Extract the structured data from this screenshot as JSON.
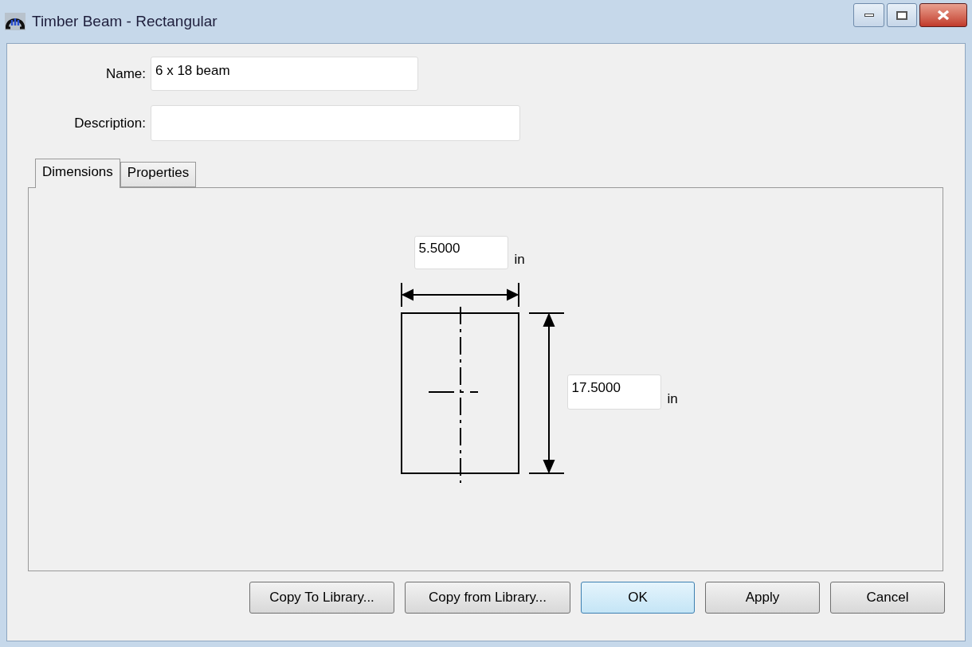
{
  "window": {
    "title": "Timber Beam - Rectangular"
  },
  "fields": [
    {
      "label": "Name:",
      "value": "6 x 18 beam"
    },
    {
      "label": "Description:"
    }
  ],
  "tabs": [
    {
      "label": "Dimensions",
      "selected": true
    },
    {
      "label": "Properties",
      "selected": false
    }
  ],
  "dimensions": {
    "width": {
      "value": "5.5000",
      "unit": "in"
    },
    "height": {
      "value": "17.5000",
      "unit": "in"
    }
  },
  "buttons": [
    {
      "label": "Copy To Library...",
      "default": false
    },
    {
      "label": "Copy from Library...",
      "default": false
    },
    {
      "label": "OK",
      "default": true
    },
    {
      "label": "Apply",
      "default": false
    },
    {
      "label": "Cancel",
      "default": false
    }
  ]
}
